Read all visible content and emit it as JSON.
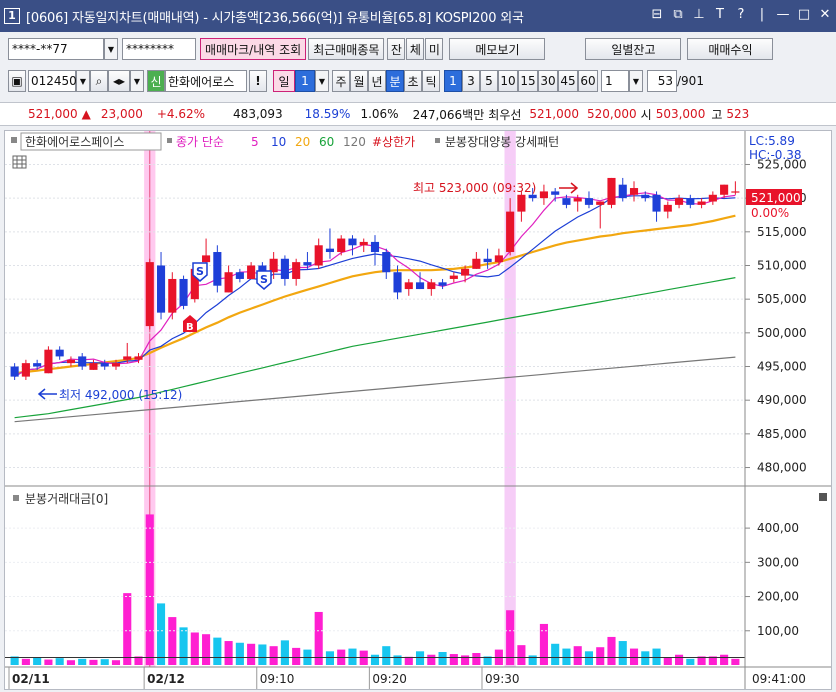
{
  "title": {
    "window_number": "1",
    "text": "[0606] 자동일지차트(매매내역) - 시가총액[236,566(억)] 유통비율[65.8] KOSPI200 외국"
  },
  "toolbar1": {
    "account": "****-**77",
    "password": "********",
    "trade_mark_btn": "매매마크/내역 조회",
    "recent_btn": "최근매매종목",
    "jan_btn": "잔",
    "che_btn": "체",
    "mi_btn": "미",
    "memo_btn": "메모보기",
    "daily_balance_btn": "일별잔고",
    "profit_btn": "매매수익"
  },
  "toolbar2": {
    "code": "012450",
    "new_badge": "신",
    "stock_name": "한화에어로스",
    "excl": "!",
    "period_il": "일",
    "period_value": "1",
    "ju": "주",
    "wol": "월",
    "nyeon": "년",
    "bun": "분",
    "cho": "초",
    "tik": "틱",
    "minutes": [
      "1",
      "3",
      "5",
      "10",
      "15",
      "30",
      "45",
      "60"
    ],
    "count_value": "1",
    "page_value": "53",
    "page_total": "/901"
  },
  "quote": {
    "price": "521,000",
    "up_arrow": "▲",
    "change": "23,000",
    "change_pct": "+4.62%",
    "volume": "483,093",
    "ratio1": "18.59%",
    "ratio2": "1.06%",
    "amount": "247,066백만",
    "best_label": "최우선",
    "best_ask": "521,000",
    "best_bid": "520,000",
    "open_label": "시",
    "open": "503,000",
    "high_label": "고",
    "high": "523"
  },
  "legend": {
    "stock": "한화에어로스페이스",
    "close_ma": "종가 단순",
    "ma5": "5",
    "ma10": "10",
    "ma20": "20",
    "ma60": "60",
    "ma120": "120",
    "limit_up": "#상한가",
    "pattern": "분봉장대양봉 강세패턴"
  },
  "annotations": {
    "lc": "LC:5.89",
    "hc": "HC:-0.38",
    "high_note": "최고 523,000 (09:32)",
    "low_note": "최저 492,000 (15:12)",
    "current_price": "521,000",
    "current_pct": "0.00%",
    "volume_label": "분봉거래대금[0]"
  },
  "axis": {
    "price_ticks": [
      "525,000",
      "520,000",
      "515,000",
      "510,000",
      "505,000",
      "500,000",
      "495,000",
      "490,000",
      "485,000",
      "480,000"
    ],
    "volume_ticks": [
      "400,00",
      "300,00",
      "200,00",
      "100,00"
    ],
    "time_labels": [
      "02/11",
      "02/12",
      "09:10",
      "09:20",
      "09:30",
      "09:41:00"
    ]
  },
  "colors": {
    "up": "#e8132a",
    "down": "#1e3fd8",
    "ma5": "#e020c0",
    "ma10": "#1d3fd6",
    "ma20": "#f2a710",
    "ma60": "#18a33a",
    "ma120": "#777777",
    "vol_up": "#ff1fd1",
    "vol_down": "#17c6ef",
    "title_bg": "#3a4f86"
  },
  "chart_data": {
    "type": "candlestick",
    "price_range": [
      478000,
      527000
    ],
    "volume_range": [
      0,
      450
    ],
    "candles": [
      {
        "o": 495000,
        "h": 495500,
        "l": 493000,
        "c": 493500
      },
      {
        "o": 493500,
        "h": 496000,
        "l": 493000,
        "c": 495500
      },
      {
        "o": 495500,
        "h": 496000,
        "l": 494500,
        "c": 495000
      },
      {
        "o": 494000,
        "h": 498000,
        "l": 494000,
        "c": 497500
      },
      {
        "o": 497500,
        "h": 498000,
        "l": 496000,
        "c": 496500
      },
      {
        "o": 495500,
        "h": 496500,
        "l": 495000,
        "c": 496000
      },
      {
        "o": 496500,
        "h": 497000,
        "l": 494500,
        "c": 495000
      },
      {
        "o": 494500,
        "h": 496000,
        "l": 494500,
        "c": 495500
      },
      {
        "o": 495500,
        "h": 496000,
        "l": 494500,
        "c": 495000
      },
      {
        "o": 495000,
        "h": 496000,
        "l": 494500,
        "c": 495500
      },
      {
        "o": 496000,
        "h": 498500,
        "l": 495500,
        "c": 496500
      },
      {
        "o": 496000,
        "h": 497000,
        "l": 495500,
        "c": 496500
      },
      {
        "o": 501000,
        "h": 511000,
        "l": 500500,
        "c": 510500
      },
      {
        "o": 510000,
        "h": 512000,
        "l": 502000,
        "c": 503000
      },
      {
        "o": 503000,
        "h": 509000,
        "l": 502000,
        "c": 508000
      },
      {
        "o": 508000,
        "h": 508500,
        "l": 503500,
        "c": 504000
      },
      {
        "o": 505000,
        "h": 510000,
        "l": 504500,
        "c": 509500
      },
      {
        "o": 510500,
        "h": 514000,
        "l": 510000,
        "c": 511500
      },
      {
        "o": 512000,
        "h": 513000,
        "l": 506000,
        "c": 507000
      },
      {
        "o": 506000,
        "h": 510000,
        "l": 506000,
        "c": 509000
      },
      {
        "o": 509000,
        "h": 509500,
        "l": 507500,
        "c": 508000
      },
      {
        "o": 508000,
        "h": 510500,
        "l": 508000,
        "c": 510000
      },
      {
        "o": 510000,
        "h": 510500,
        "l": 508000,
        "c": 509000
      },
      {
        "o": 509000,
        "h": 512000,
        "l": 508000,
        "c": 511000
      },
      {
        "o": 511000,
        "h": 511500,
        "l": 507000,
        "c": 508000
      },
      {
        "o": 508000,
        "h": 511000,
        "l": 507000,
        "c": 510500
      },
      {
        "o": 510500,
        "h": 512000,
        "l": 509500,
        "c": 510000
      },
      {
        "o": 510000,
        "h": 514000,
        "l": 509500,
        "c": 513000
      },
      {
        "o": 512500,
        "h": 515500,
        "l": 511000,
        "c": 512000
      },
      {
        "o": 512000,
        "h": 514500,
        "l": 511500,
        "c": 514000
      },
      {
        "o": 514000,
        "h": 514500,
        "l": 511500,
        "c": 513000
      },
      {
        "o": 513000,
        "h": 514000,
        "l": 512000,
        "c": 513500
      },
      {
        "o": 513500,
        "h": 514500,
        "l": 510000,
        "c": 512000
      },
      {
        "o": 512000,
        "h": 512500,
        "l": 508000,
        "c": 509000
      },
      {
        "o": 509000,
        "h": 510000,
        "l": 505000,
        "c": 506000
      },
      {
        "o": 506500,
        "h": 508000,
        "l": 505500,
        "c": 507500
      },
      {
        "o": 507500,
        "h": 509000,
        "l": 506500,
        "c": 506500
      },
      {
        "o": 506500,
        "h": 508000,
        "l": 505500,
        "c": 507500
      },
      {
        "o": 507500,
        "h": 508000,
        "l": 506500,
        "c": 507000
      },
      {
        "o": 508000,
        "h": 509000,
        "l": 507500,
        "c": 508500
      },
      {
        "o": 508500,
        "h": 510000,
        "l": 507500,
        "c": 509500
      },
      {
        "o": 509500,
        "h": 512000,
        "l": 509500,
        "c": 511000
      },
      {
        "o": 511000,
        "h": 512500,
        "l": 509500,
        "c": 510500
      },
      {
        "o": 510500,
        "h": 512500,
        "l": 510000,
        "c": 511500
      },
      {
        "o": 512000,
        "h": 520000,
        "l": 511500,
        "c": 518000
      },
      {
        "o": 518000,
        "h": 521000,
        "l": 516500,
        "c": 520500
      },
      {
        "o": 520500,
        "h": 521500,
        "l": 519500,
        "c": 520000
      },
      {
        "o": 520000,
        "h": 522000,
        "l": 519000,
        "c": 521000
      },
      {
        "o": 521000,
        "h": 521500,
        "l": 519500,
        "c": 520500
      },
      {
        "o": 520000,
        "h": 520500,
        "l": 518500,
        "c": 519000
      },
      {
        "o": 519500,
        "h": 520500,
        "l": 518000,
        "c": 520000
      },
      {
        "o": 520000,
        "h": 521000,
        "l": 518500,
        "c": 519000
      },
      {
        "o": 519000,
        "h": 519500,
        "l": 515500,
        "c": 519500
      },
      {
        "o": 519000,
        "h": 523000,
        "l": 518500,
        "c": 523000
      },
      {
        "o": 522000,
        "h": 523000,
        "l": 519500,
        "c": 520000
      },
      {
        "o": 520500,
        "h": 522500,
        "l": 519500,
        "c": 521500
      },
      {
        "o": 520500,
        "h": 521000,
        "l": 519500,
        "c": 520000
      },
      {
        "o": 520500,
        "h": 521000,
        "l": 516500,
        "c": 518000
      },
      {
        "o": 518000,
        "h": 519500,
        "l": 517000,
        "c": 519000
      },
      {
        "o": 519000,
        "h": 520500,
        "l": 518500,
        "c": 520000
      },
      {
        "o": 520000,
        "h": 520500,
        "l": 518500,
        "c": 519000
      },
      {
        "o": 519000,
        "h": 520000,
        "l": 518500,
        "c": 519500
      },
      {
        "o": 519500,
        "h": 521000,
        "l": 519000,
        "c": 520500
      },
      {
        "o": 520500,
        "h": 522000,
        "l": 520000,
        "c": 522000
      },
      {
        "o": 521000,
        "h": 522500,
        "l": 520500,
        "c": 521000
      }
    ],
    "ma20": [
      494000,
      494200,
      494400,
      494600,
      494800,
      495000,
      495200,
      495400,
      495600,
      495800,
      496000,
      496300,
      497000,
      497800,
      498500,
      499200,
      500000,
      500800,
      501500,
      502300,
      503000,
      503600,
      504200,
      504800,
      505400,
      505900,
      506400,
      506900,
      507400,
      507900,
      508400,
      508700,
      509000,
      509200,
      509300,
      509300,
      509300,
      509300,
      509400,
      509500,
      509700,
      509900,
      510200,
      510500,
      511000,
      511500,
      512000,
      512500,
      513000,
      513400,
      513700,
      514000,
      514300,
      514500,
      514800,
      515000,
      515200,
      515400,
      515600,
      515800,
      516000,
      516300,
      516600,
      517000,
      517400
    ],
    "ma60": [
      487400,
      487600,
      487800,
      488000,
      488300,
      488600,
      488900,
      489200,
      489500,
      489800,
      490100,
      490400,
      490800,
      491200,
      491600,
      492000,
      492400,
      492800,
      493200,
      493600,
      494000,
      494400,
      494800,
      495200,
      495600,
      496000,
      496400,
      496800,
      497200,
      497600,
      498000,
      498300,
      498600,
      498900,
      499200,
      499500,
      499800,
      500100,
      500400,
      500700,
      501000,
      501300,
      501600,
      501900,
      502200,
      502500,
      502800,
      503100,
      503400,
      503700,
      504000,
      504300,
      504600,
      504900,
      505200,
      505500,
      505800,
      506100,
      506400,
      506700,
      507000,
      507300,
      507600,
      507900,
      508200
    ],
    "ma120": [
      486800,
      486950,
      487100,
      487250,
      487400,
      487550,
      487700,
      487850,
      488000,
      488150,
      488300,
      488450,
      488600,
      488750,
      488900,
      489050,
      489200,
      489350,
      489500,
      489650,
      489800,
      489950,
      490100,
      490250,
      490400,
      490550,
      490700,
      490850,
      491000,
      491150,
      491300,
      491450,
      491600,
      491750,
      491900,
      492050,
      492200,
      492350,
      492500,
      492650,
      492800,
      492950,
      493100,
      493250,
      493400,
      493550,
      493700,
      493850,
      494000,
      494150,
      494300,
      494450,
      494600,
      494750,
      494900,
      495050,
      495200,
      495350,
      495500,
      495650,
      495800,
      495950,
      496100,
      496250,
      496400
    ],
    "volumes": [
      25,
      18,
      22,
      16,
      20,
      14,
      18,
      15,
      17,
      14,
      210,
      25,
      440,
      180,
      140,
      110,
      95,
      90,
      80,
      70,
      65,
      62,
      60,
      55,
      72,
      50,
      45,
      155,
      40,
      45,
      48,
      42,
      30,
      55,
      28,
      24,
      40,
      30,
      38,
      32,
      28,
      35,
      25,
      45,
      160,
      58,
      28,
      120,
      62,
      48,
      55,
      40,
      52,
      82,
      70,
      48,
      40,
      48,
      22,
      30,
      18,
      25,
      25,
      30,
      18
    ],
    "highlight_index": [
      12,
      44
    ]
  }
}
